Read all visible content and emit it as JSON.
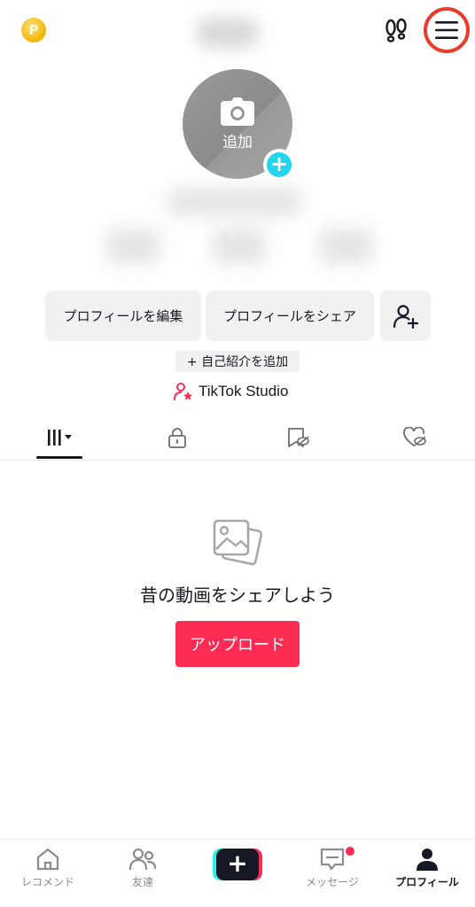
{
  "top_bar": {
    "coin_letter": "P",
    "footprints_icon": "footprints-icon",
    "menu_icon": "hamburger-menu-icon"
  },
  "avatar": {
    "add_label": "追加",
    "camera_icon": "camera-icon",
    "plus_icon": "plus-icon"
  },
  "actions": {
    "edit_profile": "プロフィールを編集",
    "share_profile": "プロフィールをシェア",
    "add_friend_icon": "add-user-icon"
  },
  "bio_button": "+ 自己紹介を追加",
  "studio_link": "TikTok Studio",
  "tabs": [
    {
      "icon": "videos-grid-icon",
      "active": true
    },
    {
      "icon": "lock-icon",
      "active": false
    },
    {
      "icon": "saved-hidden-icon",
      "active": false
    },
    {
      "icon": "liked-hidden-icon",
      "active": false
    }
  ],
  "empty_state": {
    "icon": "photos-icon",
    "message": "昔の動画をシェアしよう",
    "upload_button": "アップロード"
  },
  "bottom_nav": [
    {
      "label": "レコメンド",
      "icon": "home-icon"
    },
    {
      "label": "友達",
      "icon": "friends-icon"
    },
    {
      "label": "",
      "icon": "create-plus-icon"
    },
    {
      "label": "メッセージ",
      "icon": "inbox-icon",
      "badge": true
    },
    {
      "label": "プロフィール",
      "icon": "profile-icon",
      "active": true
    }
  ],
  "colors": {
    "accent": "#fe2c55",
    "cyan": "#20d5ec",
    "highlight_ring": "#ea3a2c"
  }
}
